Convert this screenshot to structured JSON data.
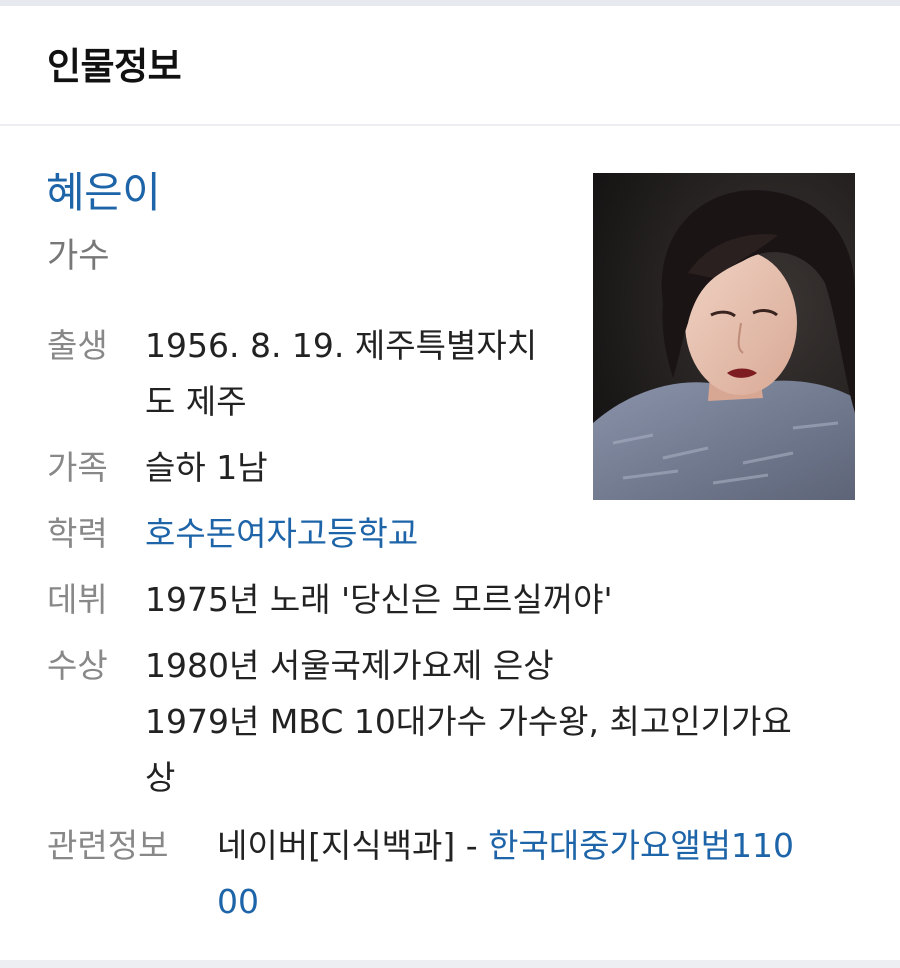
{
  "header": {
    "title": "인물정보"
  },
  "person": {
    "name": "혜은이",
    "occupation": "가수"
  },
  "info": {
    "birth": {
      "label": "출생",
      "line1": "1956. 8. 19. 제주특별자치",
      "line2": "도 제주"
    },
    "family": {
      "label": "가족",
      "value": "슬하 1남"
    },
    "education": {
      "label": "학력",
      "value": "호수돈여자고등학교"
    },
    "debut": {
      "label": "데뷔",
      "value": "1975년 노래 '당신은 모르실꺼야'"
    },
    "awards": {
      "label": "수상",
      "line1": "1980년 서울국제가요제 은상",
      "line2": "1979년 MBC 10대가수 가수왕, 최고인기가요",
      "line3": "상"
    },
    "related": {
      "label": "관련정보",
      "source": "네이버[지식백과] - ",
      "link_line1": "한국대중가요앨범110",
      "link_line2": "00"
    }
  },
  "colors": {
    "link": "#1d64a8",
    "label": "#888888",
    "text": "#222222",
    "divider": "#eceef1"
  },
  "icons": {
    "portrait": "person-portrait-photo"
  }
}
